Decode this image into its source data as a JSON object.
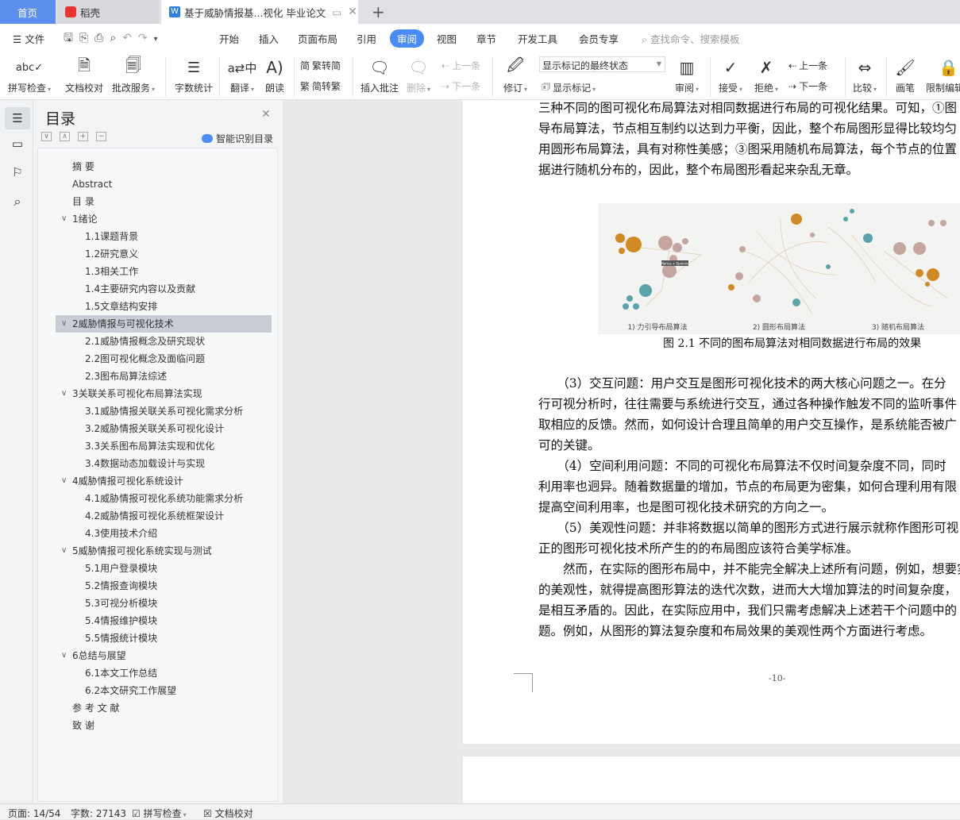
{
  "tabs": [
    {
      "label": "首页",
      "active": false
    },
    {
      "label": "稻壳"
    },
    {
      "label": "基于威胁情报基...视化 毕业论文",
      "active": true
    }
  ],
  "colors": {
    "accent": "#4a8cf7",
    "home_tab": "#5b8ff0",
    "daoke": "#e8342f"
  },
  "menu": {
    "file": "文件",
    "items": [
      "开始",
      "插入",
      "页面布局",
      "引用",
      "审阅",
      "视图",
      "章节",
      "开发工具",
      "会员专享"
    ],
    "active": "审阅",
    "search_placeholder": "查找命令、搜索模板"
  },
  "ribbon": {
    "spell": "拼写检查",
    "proof": "文档校对",
    "correct": "批改服务",
    "wordcount": "字数统计",
    "translate": "翻译",
    "read": "朗读",
    "t2s": "繁转简",
    "s2t": "简转繁",
    "insert_comment": "插入批注",
    "delete": "删除",
    "prev": "上一条",
    "next": "下一条",
    "revise": "修订",
    "markup_select": "显示标记的最终状态",
    "show_markup": "显示标记",
    "review": "审阅",
    "accept": "接受",
    "reject": "拒绝",
    "prev2": "上一条",
    "next2": "下一条",
    "compare": "比较",
    "pen": "画笔",
    "restrict": "限制编辑"
  },
  "toc": {
    "title": "目录",
    "smart": "智能识别目录",
    "items": [
      {
        "label": "摘 要",
        "level": 1
      },
      {
        "label": "Abstract",
        "level": 1
      },
      {
        "label": "目 录",
        "level": 1
      },
      {
        "label": "1绪论",
        "level": 1,
        "expand": true
      },
      {
        "label": "1.1课题背景",
        "level": 2
      },
      {
        "label": "1.2研究意义",
        "level": 2
      },
      {
        "label": "1.3相关工作",
        "level": 2
      },
      {
        "label": "1.4主要研究内容以及贡献",
        "level": 2
      },
      {
        "label": "1.5文章结构安排",
        "level": 2
      },
      {
        "label": "2威胁情报与可视化技术",
        "level": 1,
        "expand": true,
        "selected": true
      },
      {
        "label": "2.1威胁情报概念及研究现状",
        "level": 2
      },
      {
        "label": "2.2图可视化概念及面临问题",
        "level": 2
      },
      {
        "label": "2.3图布局算法综述",
        "level": 2
      },
      {
        "label": "3关联关系可视化布局算法实现",
        "level": 1,
        "expand": true
      },
      {
        "label": "3.1威胁情报关联关系可视化需求分析",
        "level": 2
      },
      {
        "label": "3.2威胁情报关联关系可视化设计",
        "level": 2
      },
      {
        "label": "3.3关系图布局算法实现和优化",
        "level": 2
      },
      {
        "label": "3.4数据动态加载设计与实现",
        "level": 2
      },
      {
        "label": "4威胁情报可视化系统设计",
        "level": 1,
        "expand": true
      },
      {
        "label": "4.1威胁情报可视化系统功能需求分析",
        "level": 2
      },
      {
        "label": "4.2威胁情报可视化系统框架设计",
        "level": 2
      },
      {
        "label": "4.3使用技术介绍",
        "level": 2
      },
      {
        "label": "5威胁情报可视化系统实现与测试",
        "level": 1,
        "expand": true
      },
      {
        "label": "5.1用户登录模块",
        "level": 2
      },
      {
        "label": "5.2情报查询模块",
        "level": 2
      },
      {
        "label": "5.3可视分析模块",
        "level": 2
      },
      {
        "label": "5.4情报维护模块",
        "level": 2
      },
      {
        "label": "5.5情报统计模块",
        "level": 2
      },
      {
        "label": "6总结与展望",
        "level": 1,
        "expand": true
      },
      {
        "label": "6.1本文工作总结",
        "level": 2
      },
      {
        "label": "6.2本文研究工作展望",
        "level": 2
      },
      {
        "label": "参 考 文 献",
        "level": 1
      },
      {
        "label": "致 谢",
        "level": 1
      }
    ]
  },
  "doc": {
    "lines_top": [
      "三种不同的图可视化布局算法对相同数据进行布局的可视化结果。可知，①图",
      "导布局算法，节点相互制约以达到力平衡，因此，整个布局图形显得比较均匀",
      "用圆形布局算法，具有对称性美感；③图采用随机布局算法，每个节点的位置",
      "据进行随机分布的，因此，整个布局图形看起来杂乱无章。"
    ],
    "figure_labels": [
      "1) 力引导布局算法",
      "2) 圆形布局算法",
      "3) 随机布局算法"
    ],
    "figure_tooltip": "Marius + Eponine",
    "caption": "图 2.1 不同的图布局算法对相同数据进行布局的效果",
    "lines_bottom": [
      "　　（3）交互问题：用户交互是图形可视化技术的两大核心问题之一。在分",
      "行可视分析时，往往需要与系统进行交互，通过各种操作触发不同的监听事件",
      "取相应的反馈。然而，如何设计合理且简单的用户交互操作，是系统能否被广",
      "可的关键。",
      "　　（4）空间利用问题：不同的可视化布局算法不仅时间复杂度不同，同时",
      "利用率也迥异。随着数据量的增加，节点的布局更为密集，如何合理利用有限",
      "提高空间利用率，也是图可视化技术研究的方向之一。",
      "　　（5）美观性问题：并非将数据以简单的图形方式进行展示就称作图形可视",
      "正的图形可视化技术所产生的的布局图应该符合美学标准。",
      "　　然而，在实际的图形布局中，并不能完全解决上述所有问题，例如，想要实现",
      "的美观性，就得提高图形算法的迭代次数，进而大大增加算法的时间复杂度，",
      "是相互矛盾的。因此，在实际应用中，我们只需考虑解决上述若干个问题中的",
      "题。例如，从图形的算法复杂度和布局效果的美观性两个方面进行考虑。"
    ],
    "page_number": "-10-"
  },
  "status": {
    "page": "页面: 14/54",
    "words": "字数: 27143",
    "spell": "拼写检查",
    "proof": "文档校对"
  }
}
